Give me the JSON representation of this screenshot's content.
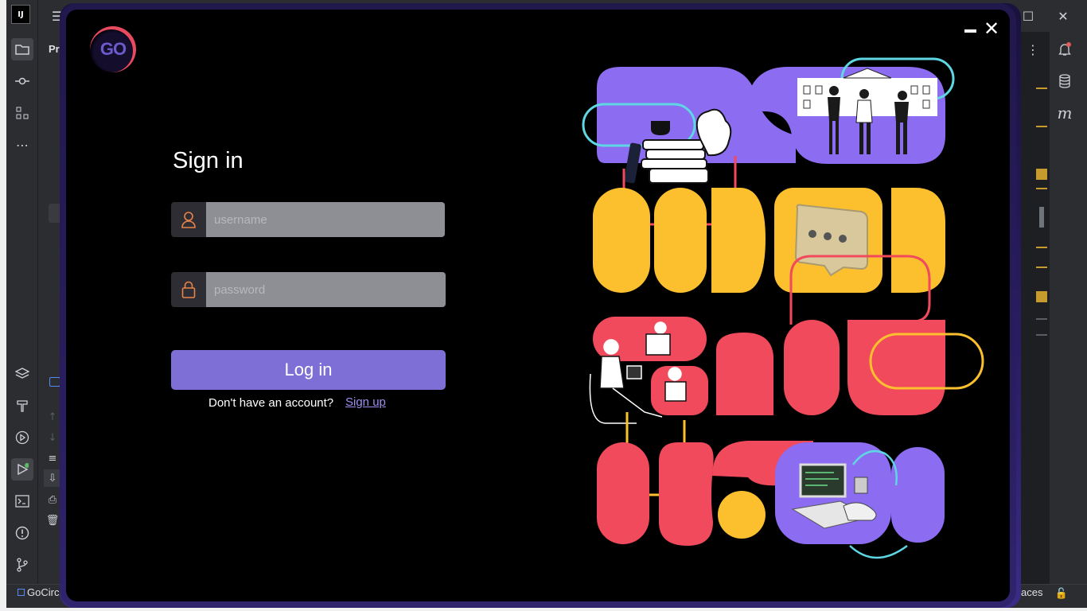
{
  "ide": {
    "project_label": "Proj",
    "statusbar_left": "GoCircle",
    "statusbar_right": "aces",
    "icons": [
      "ij-logo-icon",
      "hamburger-menu-icon",
      "folder-icon",
      "commit-icon",
      "structure-icon",
      "more-icon",
      "layers-icon",
      "build-icon",
      "run-service-icon",
      "run-icon",
      "terminal-icon",
      "problems-icon",
      "git-icon",
      "notifications-icon",
      "database-icon",
      "maven-icon",
      "minimize-window-icon",
      "maximize-window-icon",
      "close-window-icon"
    ]
  },
  "dialog": {
    "logo_text": "GO",
    "title": "Sign in",
    "username": {
      "placeholder": "username",
      "value": ""
    },
    "password": {
      "placeholder": "password",
      "value": ""
    },
    "login_label": "Log in",
    "no_account_text": "Don't have an account?",
    "signup_label": "Sign up",
    "colors": {
      "accent": "#7e6fd6",
      "purple": "#8c6cf0",
      "yellow": "#fcc02e",
      "red": "#f14a5c",
      "cyan": "#5fd6e4",
      "field_bg": "#8e8f95",
      "icon_orange": "#e8834a"
    }
  }
}
